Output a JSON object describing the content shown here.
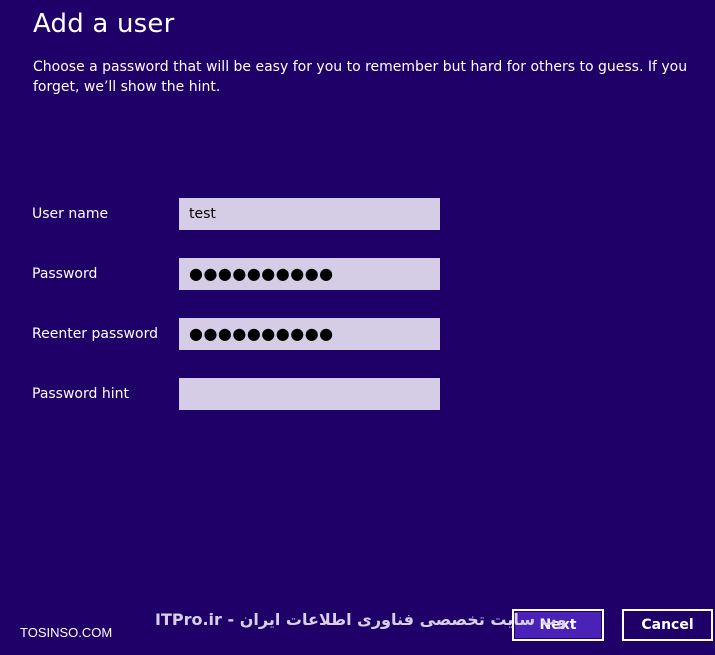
{
  "header": {
    "title": "Add a user",
    "description": "Choose a password that will be easy for you to remember but hard for others to guess. If you forget, we’ll show the hint."
  },
  "form": {
    "fields": [
      {
        "label": "User name",
        "value": "test"
      },
      {
        "label": "Password",
        "value": "●●●●●●●●●●"
      },
      {
        "label": "Reenter password",
        "value": "●●●●●●●●●●"
      },
      {
        "label": "Password hint",
        "value": ""
      }
    ]
  },
  "buttons": {
    "next": "Next",
    "cancel": "Cancel"
  },
  "watermarks": {
    "left": "TOSINSO.COM",
    "right": "ITPro.ir - وب سایت تخصصی فناوری اطلاعات ایران"
  },
  "colors": {
    "background": "#1f0068",
    "field": "#d5cce6",
    "next_button": "#4a22b8"
  }
}
